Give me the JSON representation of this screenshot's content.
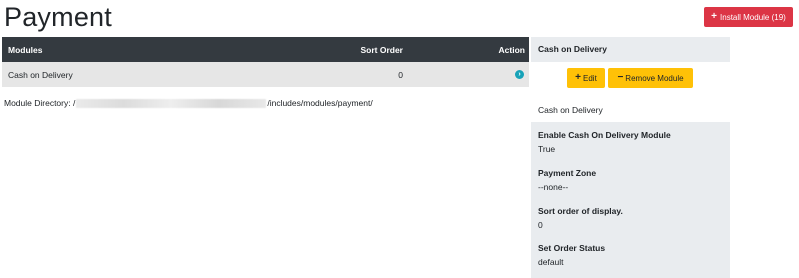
{
  "page": {
    "title": "Payment"
  },
  "header": {
    "install_label": "Install Module (19)"
  },
  "table": {
    "columns": [
      "Modules",
      "Sort Order",
      "Action"
    ],
    "rows": [
      {
        "name": "Cash on Delivery",
        "sort_order": "0"
      }
    ]
  },
  "module_dir": {
    "prefix": "Module Directory: /",
    "suffix": "/includes/modules/payment/"
  },
  "sidebar": {
    "heading": "Cash on Delivery",
    "edit_label": "Edit",
    "remove_label": "Remove Module",
    "module_title": "Cash on Delivery",
    "fields": [
      {
        "label": "Enable Cash On Delivery Module",
        "value": "True"
      },
      {
        "label": "Payment Zone",
        "value": "--none--"
      },
      {
        "label": "Sort order of display.",
        "value": "0"
      },
      {
        "label": "Set Order Status",
        "value": "default"
      }
    ]
  },
  "colors": {
    "danger": "#dc3545",
    "warning": "#ffc107",
    "dark": "#343a40",
    "info": "#17a2b8"
  }
}
